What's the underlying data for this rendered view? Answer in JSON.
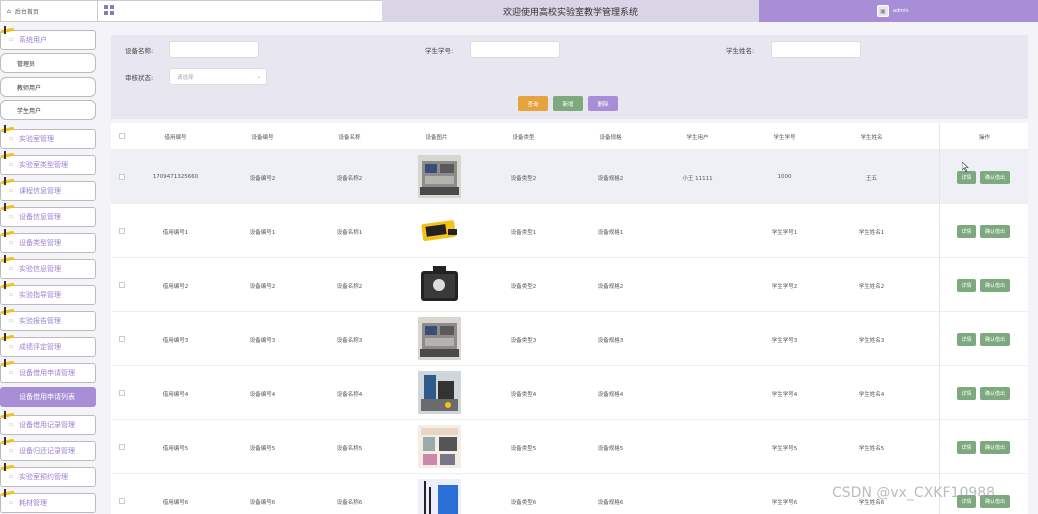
{
  "topbar": {
    "home_label": "后台首页",
    "title": "欢迎使用高校实验室教学管理系统",
    "user_name": "admin"
  },
  "sidebar": {
    "items": [
      {
        "label": "系统用户",
        "type": "group"
      },
      {
        "label": "管理员",
        "type": "sub"
      },
      {
        "label": "教师用户",
        "type": "sub"
      },
      {
        "label": "学生用户",
        "type": "sub"
      },
      {
        "label": "实验室管理",
        "type": "group"
      },
      {
        "label": "实验室类型管理",
        "type": "group"
      },
      {
        "label": "课程信息管理",
        "type": "group"
      },
      {
        "label": "设备信息管理",
        "type": "group"
      },
      {
        "label": "设备类型管理",
        "type": "group"
      },
      {
        "label": "实验信息管理",
        "type": "group"
      },
      {
        "label": "实验指导管理",
        "type": "group"
      },
      {
        "label": "实验报告管理",
        "type": "group"
      },
      {
        "label": "成绩评定管理",
        "type": "group"
      },
      {
        "label": "设备借用申请管理",
        "type": "group"
      },
      {
        "label": "设备借用申请列表",
        "type": "active"
      },
      {
        "label": "设备借用记录管理",
        "type": "group"
      },
      {
        "label": "设备归还记录管理",
        "type": "group"
      },
      {
        "label": "实验室预约管理",
        "type": "group"
      },
      {
        "label": "耗材管理",
        "type": "group"
      }
    ]
  },
  "search": {
    "device_name_label": "设备名称:",
    "student_id_label": "学生学号:",
    "student_name_label": "学生姓名:",
    "review_status_label": "审核状态:",
    "review_status_placeholder": "请选择",
    "search_btn": "查询",
    "add_btn": "新增",
    "delete_btn": "删除"
  },
  "table": {
    "headers": [
      "借用编号",
      "设备编号",
      "设备名称",
      "设备图片",
      "设备类型",
      "设备规格",
      "学生用户",
      "学生学号",
      "学生姓名",
      "操作"
    ],
    "rows": [
      {
        "borrow_no": "1709471325660",
        "device_no": "设备编号2",
        "device_name": "设备名称2",
        "device_type": "设备类型2",
        "device_spec": "设备规格2",
        "student_user": "小王 11111",
        "student_id": "1000",
        "student_name": "王五",
        "image": "lab-bench-photo"
      },
      {
        "borrow_no": "借用编号1",
        "device_no": "设备编号1",
        "device_name": "设备名称1",
        "device_type": "设备类型1",
        "device_spec": "设备规格1",
        "student_user": "",
        "student_id": "学生学号1",
        "student_name": "学生姓名1",
        "image": "yellow-meter-photo"
      },
      {
        "borrow_no": "借用编号2",
        "device_no": "设备编号2",
        "device_name": "设备名称2",
        "device_type": "设备类型2",
        "device_spec": "设备规格2",
        "student_user": "",
        "student_id": "学生学号2",
        "student_name": "学生姓名2",
        "image": "tool-case-photo"
      },
      {
        "borrow_no": "借用编号3",
        "device_no": "设备编号3",
        "device_name": "设备名称3",
        "device_type": "设备类型3",
        "device_spec": "设备规格3",
        "student_user": "",
        "student_id": "学生学号3",
        "student_name": "学生姓名3",
        "image": "lab-bench-photo"
      },
      {
        "borrow_no": "借用编号4",
        "device_no": "设备编号4",
        "device_name": "设备名称4",
        "device_type": "设备类型4",
        "device_spec": "设备规格4",
        "student_user": "",
        "student_id": "学生学号4",
        "student_name": "学生姓名4",
        "image": "lab-setup-photo"
      },
      {
        "borrow_no": "借用编号5",
        "device_no": "设备编号5",
        "device_name": "设备名称5",
        "device_type": "设备类型5",
        "device_spec": "设备规格5",
        "student_user": "",
        "student_id": "学生学号5",
        "student_name": "学生姓名5",
        "image": "poster-photo"
      },
      {
        "borrow_no": "借用编号6",
        "device_no": "设备编号6",
        "device_name": "设备名称6",
        "device_type": "设备类型6",
        "device_spec": "设备规格6",
        "student_user": "",
        "student_id": "学生学号6",
        "student_name": "学生姓名6",
        "image": "blue-panel-photo"
      }
    ],
    "detail_btn": "详情",
    "confirm_btn": "确认借出"
  },
  "watermark": "CSDN @vx_CXKF10988",
  "colors": {
    "accent": "#a88ed6",
    "title_bg": "#d9d4e6",
    "search_btn": "#e6a23c",
    "green_btn": "#7ea87e"
  }
}
